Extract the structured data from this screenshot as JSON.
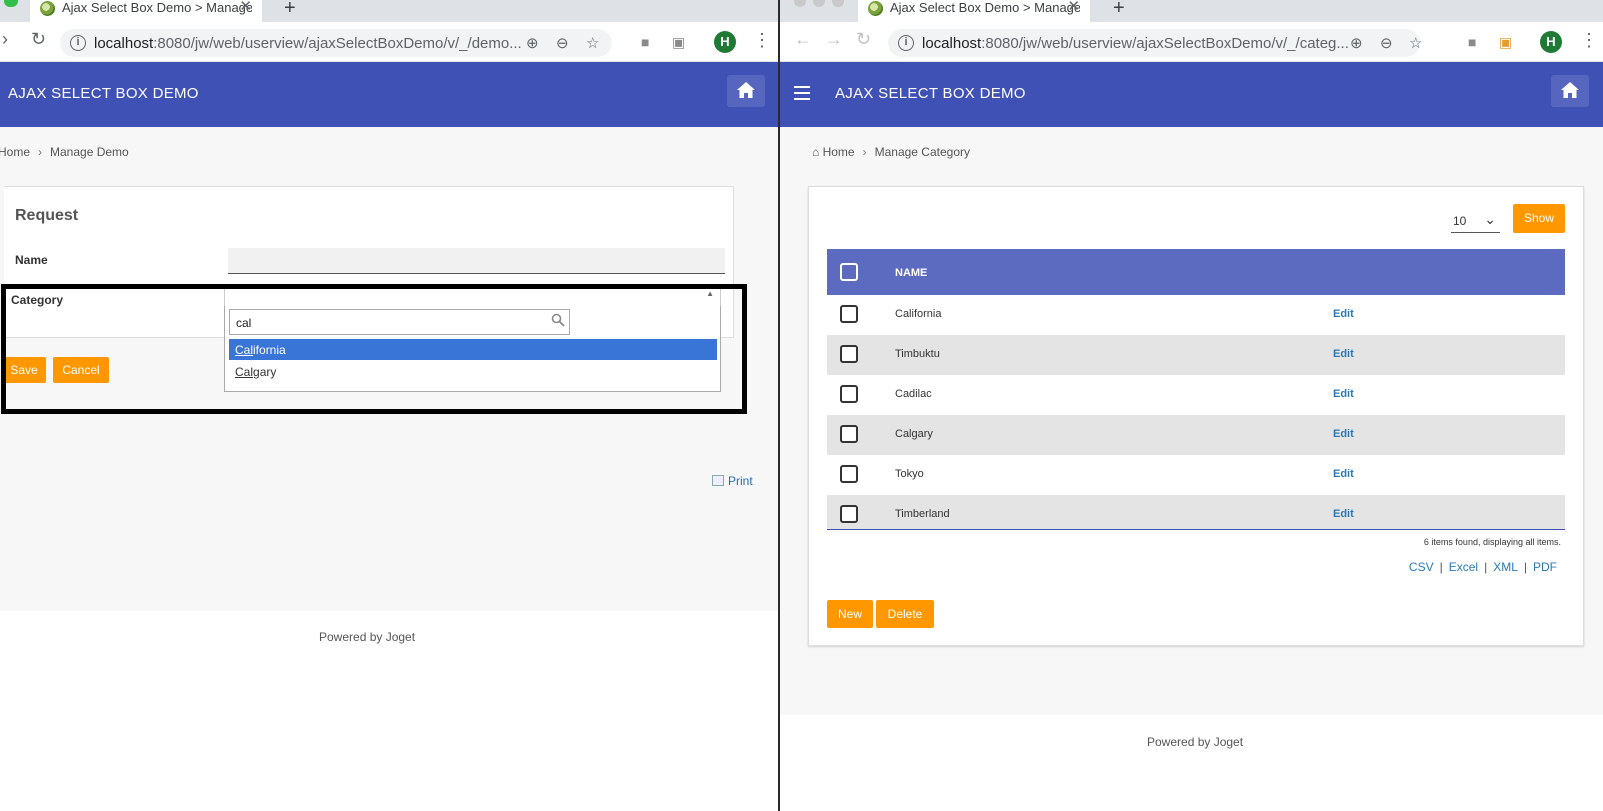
{
  "left": {
    "tab_title": "Ajax Select Box Demo > Manage Demo",
    "url_host": "localhost",
    "url_rest": ":8080/jw/web/userview/ajaxSelectBoxDemo/v/_/demo...",
    "avatar_letter": "H",
    "app_title": "AJAX SELECT BOX DEMO",
    "breadcrumb": {
      "home": "Home",
      "current": "Manage Demo"
    },
    "form": {
      "title": "Request",
      "name_label": "Name",
      "category_label": "Category",
      "search_query": "cal",
      "options": [
        {
          "match": "Cal",
          "rest": "ifornia",
          "highlighted": true
        },
        {
          "match": "Cal",
          "rest": "gary",
          "highlighted": false
        }
      ],
      "save_label": "Save",
      "cancel_label": "Cancel"
    },
    "print_label": "Print",
    "powered_by": "Powered by Joget"
  },
  "right": {
    "tab_title": "Ajax Select Box Demo > Manage Category",
    "url_host": "localhost",
    "url_rest": ":8080/jw/web/userview/ajaxSelectBoxDemo/v/_/categ...",
    "avatar_letter": "H",
    "app_title": "AJAX SELECT BOX DEMO",
    "breadcrumb": {
      "home": "Home",
      "current": "Manage Category"
    },
    "page_size": "10",
    "show_label": "Show",
    "column_name": "NAME",
    "rows": [
      {
        "name": "California",
        "action": "Edit"
      },
      {
        "name": "Timbuktu",
        "action": "Edit"
      },
      {
        "name": "Cadilac",
        "action": "Edit"
      },
      {
        "name": "Calgary",
        "action": "Edit"
      },
      {
        "name": "Tokyo",
        "action": "Edit"
      },
      {
        "name": "Timberland",
        "action": "Edit"
      }
    ],
    "summary": "6 items found, displaying all items.",
    "exports": [
      "CSV",
      "Excel",
      "XML",
      "PDF"
    ],
    "new_label": "New",
    "delete_label": "Delete",
    "powered_by": "Powered by Joget"
  },
  "colors": {
    "header": "#3f51b5",
    "table_header": "#5c6bc0",
    "accent": "#ff9800",
    "link": "#2a7ab8",
    "selected_option": "#3875d7"
  },
  "icons": [
    "back-arrow-icon",
    "forward-arrow-icon",
    "reload-icon",
    "info-icon",
    "add-icon",
    "zoom-icon",
    "star-icon",
    "camera-icon",
    "extension-icon",
    "menu-kebab-icon",
    "home-icon",
    "hamburger-menu-icon",
    "search-icon",
    "dropdown-caret-icon",
    "print-icon",
    "chevron-down-icon"
  ]
}
